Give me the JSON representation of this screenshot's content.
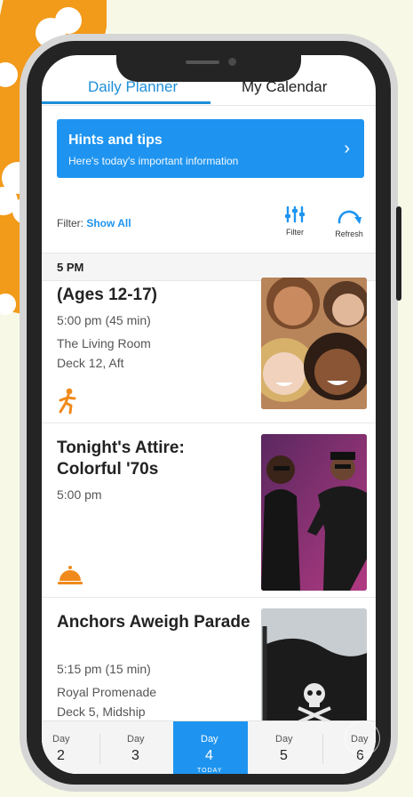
{
  "tabs": [
    {
      "label": "Daily Planner",
      "active": true
    },
    {
      "label": "My Calendar",
      "active": false
    }
  ],
  "hints": {
    "title": "Hints and tips",
    "subtitle": "Here's today's important information"
  },
  "filter": {
    "prefix": "Filter:",
    "value": "Show All"
  },
  "tools": {
    "filter_label": "Filter",
    "refresh_label": "Refresh"
  },
  "time_header": "5 PM",
  "events": [
    {
      "title": "(Ages 12-17)",
      "time": "5:00 pm (45 min)",
      "location": "The Living Room",
      "deck": "Deck 12, Aft",
      "icon": "activity-figure-icon"
    },
    {
      "title": "Tonight's Attire: Colorful '70s",
      "time": "5:00 pm",
      "icon": "service-bell-icon"
    },
    {
      "title": "Anchors Aweigh Parade",
      "time": "5:15 pm (15 min)",
      "location": "Royal Promenade",
      "deck": "Deck 5, Midship"
    }
  ],
  "days": [
    {
      "label": "Day",
      "number": "2",
      "active": false
    },
    {
      "label": "Day",
      "number": "3",
      "active": false
    },
    {
      "label": "Day",
      "number": "4",
      "active": true,
      "sub": "TODAY"
    },
    {
      "label": "Day",
      "number": "5",
      "active": false
    },
    {
      "label": "Day",
      "number": "6",
      "active": false
    }
  ],
  "colors": {
    "accent": "#1e94f0",
    "tab_active": "#1e8fd8",
    "activity_icon": "#f08a1c",
    "background": "#f7f8e6",
    "decor_orange": "#f29a1a"
  }
}
